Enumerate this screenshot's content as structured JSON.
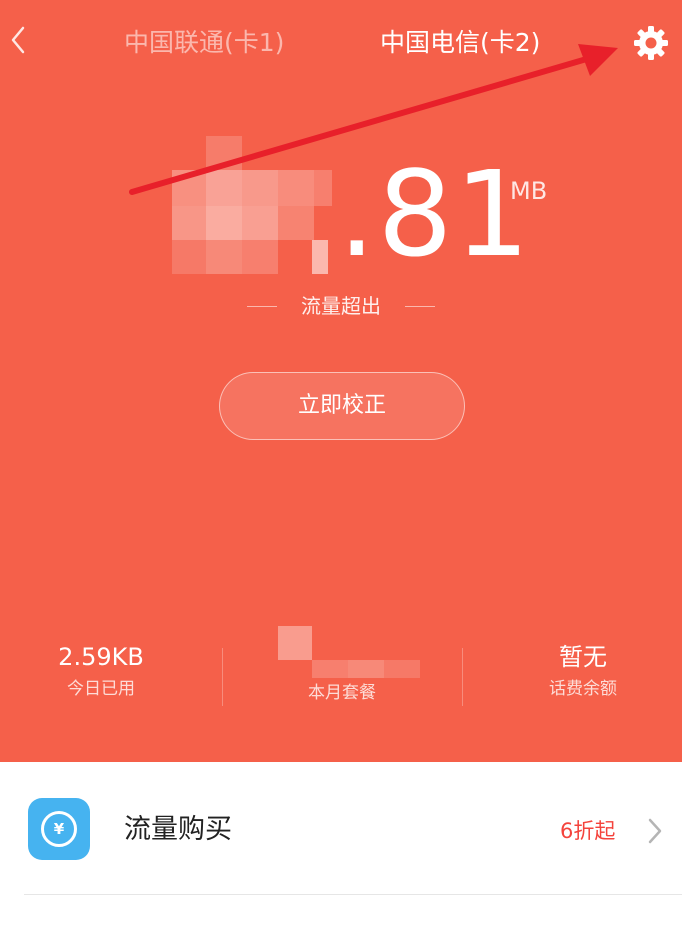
{
  "header": {
    "back_icon": "chevron-left-icon",
    "tabs": [
      {
        "label": "中国联通(卡1)",
        "active": false
      },
      {
        "label": "中国电信(卡2)",
        "active": true
      }
    ],
    "settings_icon": "gear-icon"
  },
  "usage": {
    "value_visible": ".81",
    "unit": "MB",
    "status": "流量超出",
    "calibrate_label": "立即校正"
  },
  "stats": [
    {
      "value": "2.59KB",
      "label": "今日已用"
    },
    {
      "value": "",
      "label": "本月套餐"
    },
    {
      "value": "暂无",
      "label": "话费余额"
    }
  ],
  "buy_row": {
    "icon": "yuan-coin-icon",
    "label": "流量购买",
    "discount": "6折起",
    "chevron_icon": "chevron-right-icon"
  },
  "colors": {
    "hero_bg": "#f5604a",
    "discount": "#f4433c",
    "buy_icon_bg": "#46b3f0",
    "annotation_arrow": "#e8202a"
  }
}
